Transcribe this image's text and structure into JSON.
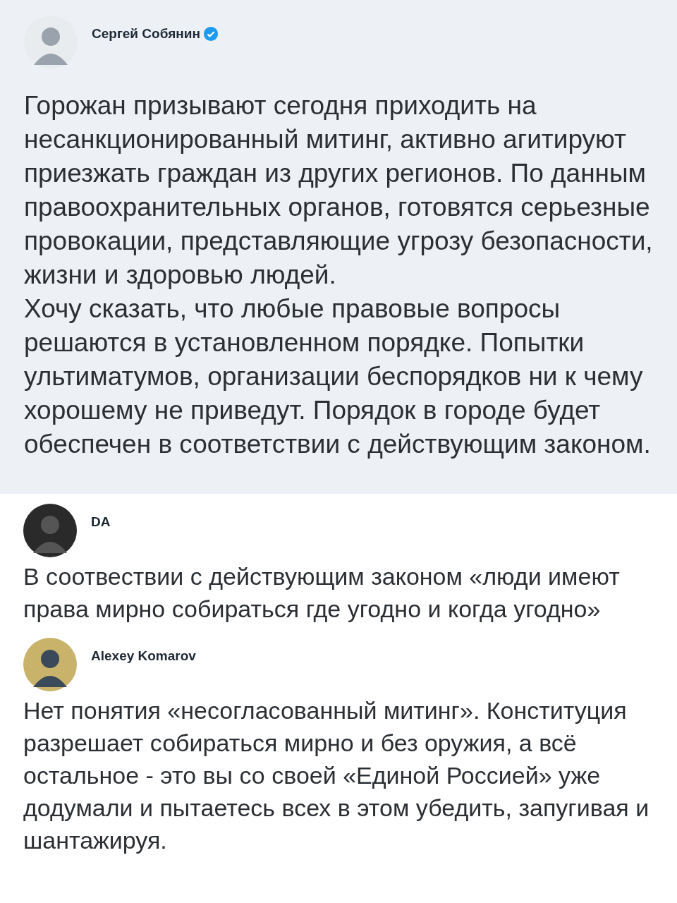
{
  "main_post": {
    "author": "Сергей Собянин",
    "verified": true,
    "paragraphs": [
      "Горожан призывают сегодня приходить на несанкционированный митинг, активно агитируют приезжать граждан из других регионов. По данным правоохранительных органов, готовятся серьезные провокации, представляющие угрозу безопасности, жизни и здоровью людей.",
      "Хочу сказать, что любые правовые вопросы решаются в установленном порядке. Попытки ультиматумов, организации беспорядков ни к чему хорошему не приведут. Порядок в городе будет обеспечен в соответствии с действующим законом."
    ]
  },
  "replies": [
    {
      "author": "DA",
      "paragraphs": [
        "В соотвествии с действующим законом «люди имеют права мирно собираться где угодно и когда угодно»"
      ]
    },
    {
      "author": "Alexey Komarov",
      "paragraphs": [
        "Нет понятия «несогласованный митинг».  Конституция разрешает собираться мирно и без оружия, а всё остальное - это вы со своей «Единой Россией» уже додумали и пытаетесь всех в этом убедить, запугивая и шантажируя."
      ]
    }
  ]
}
